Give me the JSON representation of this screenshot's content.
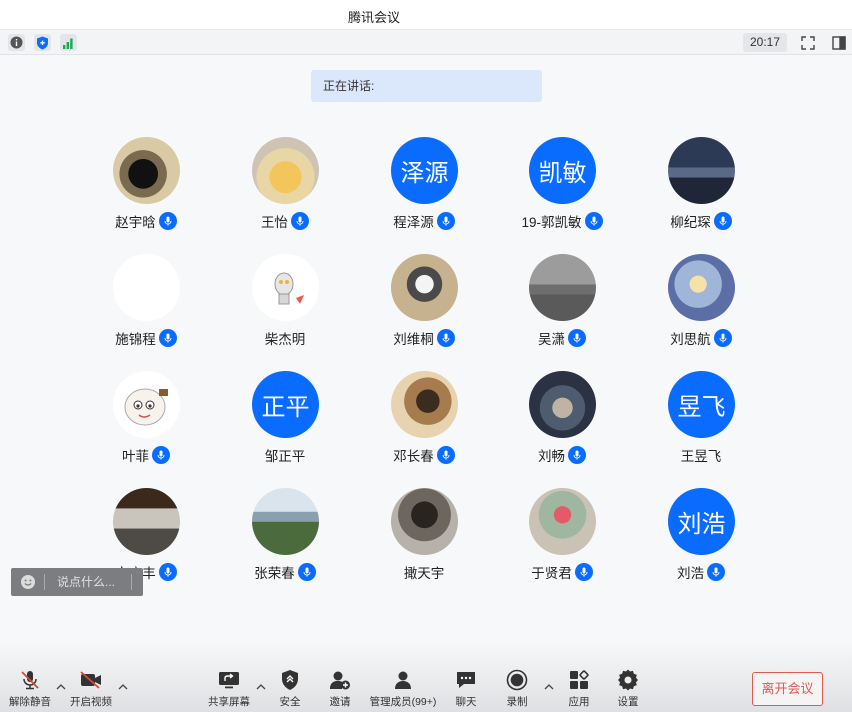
{
  "window": {
    "title": "腾讯会议"
  },
  "status": {
    "time": "20:17"
  },
  "speaking": {
    "label": "正在讲话:"
  },
  "participants": [
    {
      "name": "赵宇晗",
      "avatar_text": "",
      "avatar": "photo",
      "mic": true
    },
    {
      "name": "王怡",
      "avatar_text": "",
      "avatar": "photo",
      "mic": true
    },
    {
      "name": "程泽源",
      "avatar_text": "泽源",
      "avatar": "text",
      "mic": true
    },
    {
      "name": "19-郭凯敏",
      "avatar_text": "凯敏",
      "avatar": "text",
      "mic": true
    },
    {
      "name": "柳纪琛",
      "avatar_text": "",
      "avatar": "photo",
      "mic": true
    },
    {
      "name": "施锦程",
      "avatar_text": "",
      "avatar": "blank",
      "mic": true
    },
    {
      "name": "柴杰明",
      "avatar_text": "",
      "avatar": "photo",
      "mic": false
    },
    {
      "name": "刘维桐",
      "avatar_text": "",
      "avatar": "photo",
      "mic": true
    },
    {
      "name": "吴潇",
      "avatar_text": "",
      "avatar": "photo",
      "mic": true
    },
    {
      "name": "刘思航",
      "avatar_text": "",
      "avatar": "photo",
      "mic": true
    },
    {
      "name": "叶菲",
      "avatar_text": "",
      "avatar": "photo",
      "mic": true
    },
    {
      "name": "邹正平",
      "avatar_text": "正平",
      "avatar": "text",
      "mic": false
    },
    {
      "name": "邓长春",
      "avatar_text": "",
      "avatar": "photo",
      "mic": true
    },
    {
      "name": "刘畅",
      "avatar_text": "",
      "avatar": "photo",
      "mic": true
    },
    {
      "name": "王昱飞",
      "avatar_text": "昱飞",
      "avatar": "text",
      "mic": false
    },
    {
      "name": "安广丰",
      "avatar_text": "",
      "avatar": "photo",
      "mic": true
    },
    {
      "name": "张荣春",
      "avatar_text": "",
      "avatar": "photo",
      "mic": true
    },
    {
      "name": "撖天宇",
      "avatar_text": "",
      "avatar": "photo",
      "mic": false
    },
    {
      "name": "于贤君",
      "avatar_text": "",
      "avatar": "photo",
      "mic": true
    },
    {
      "name": "刘浩",
      "avatar_text": "刘浩",
      "avatar": "text",
      "mic": true
    }
  ],
  "chat": {
    "placeholder": "说点什么..."
  },
  "toolbar": {
    "unmute": "解除静音",
    "video": "开启视频",
    "share": "共享屏幕",
    "security": "安全",
    "invite": "邀请",
    "members": "管理成员(99+)",
    "chat": "聊天",
    "record": "录制",
    "apps": "应用",
    "settings": "设置",
    "leave": "离开会议"
  },
  "colors": {
    "accent": "#0a6cff",
    "leave": "#e05a4f",
    "speaking_bg": "#dbe8fb"
  }
}
